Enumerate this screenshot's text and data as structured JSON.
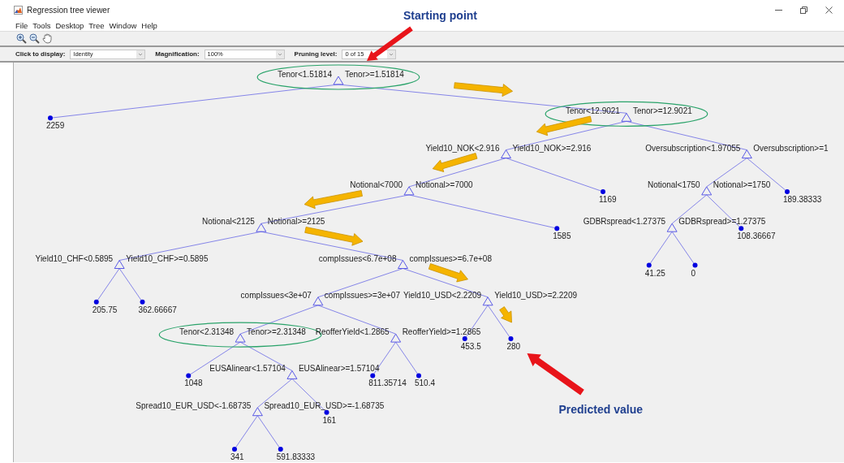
{
  "window": {
    "title": "Regression tree viewer"
  },
  "menu": [
    "File",
    "Tools",
    "Desktop",
    "Tree",
    "Window",
    "Help"
  ],
  "options": [
    {
      "label": "Click to display:",
      "value": "Identity"
    },
    {
      "label": "Magnification:",
      "value": "100%"
    },
    {
      "label": "Pruning level:",
      "value": "0 of 15"
    }
  ],
  "tree": {
    "kind": "split",
    "left_label": "Tenor<1.51814",
    "right_label": "Tenor>=1.51814",
    "highlighted": true,
    "children": [
      {
        "kind": "leaf",
        "value": "2259",
        "on_path": false
      },
      {
        "kind": "split",
        "left_label": "Tenor<12.9021",
        "right_label": "Tenor>=12.9021",
        "highlighted": true,
        "on_path": true,
        "children": [
          {
            "kind": "split",
            "left_label": "Yield10_NOK<2.916",
            "right_label": "Yield10_NOK>=2.916",
            "highlighted": false,
            "on_path": true,
            "children": [
              {
                "kind": "split",
                "left_label": "Notional<7000",
                "right_label": "Notional>=7000",
                "highlighted": false,
                "on_path": true,
                "children": [
                  {
                    "kind": "split",
                    "left_label": "Notional<2125",
                    "right_label": "Notional>=2125",
                    "highlighted": false,
                    "on_path": true,
                    "children": [
                      {
                        "kind": "split",
                        "left_label": "Yield10_CHF<0.5895",
                        "right_label": "Yield10_CHF>=0.5895",
                        "highlighted": false,
                        "on_path": false,
                        "children": [
                          {
                            "kind": "leaf",
                            "value": "205.75",
                            "on_path": false
                          },
                          {
                            "kind": "leaf",
                            "value": "362.66667",
                            "on_path": false
                          }
                        ]
                      },
                      {
                        "kind": "split",
                        "left_label": "compIssues<6.7e+08",
                        "right_label": "compIssues>=6.7e+08",
                        "highlighted": false,
                        "on_path": true,
                        "children": [
                          {
                            "kind": "split",
                            "left_label": "compIssues<3e+07",
                            "right_label": "compIssues>=3e+07",
                            "highlighted": false,
                            "on_path": false,
                            "children": [
                              {
                                "kind": "split",
                                "left_label": "Tenor<2.31348",
                                "right_label": "Tenor>=2.31348",
                                "highlighted": true,
                                "on_path": false,
                                "children": [
                                  {
                                    "kind": "leaf",
                                    "value": "1048",
                                    "on_path": false
                                  },
                                  {
                                    "kind": "split",
                                    "left_label": "EUSAlinear<1.57104",
                                    "right_label": "EUSAlinear>=1.57104",
                                    "highlighted": false,
                                    "on_path": false,
                                    "children": [
                                      {
                                        "kind": "split",
                                        "left_label": "Spread10_EUR_USD<-1.68735",
                                        "right_label": "Spread10_EUR_USD>=-1.68735",
                                        "highlighted": false,
                                        "on_path": false,
                                        "children": [
                                          {
                                            "kind": "leaf",
                                            "value": "341",
                                            "on_path": false
                                          },
                                          {
                                            "kind": "leaf",
                                            "value": "591.83333",
                                            "on_path": false
                                          }
                                        ]
                                      },
                                      {
                                        "kind": "leaf",
                                        "value": "161",
                                        "on_path": false
                                      }
                                    ]
                                  }
                                ]
                              },
                              {
                                "kind": "split",
                                "left_label": "ReofferYield<1.2865",
                                "right_label": "ReofferYield>=1.2865",
                                "highlighted": false,
                                "on_path": false,
                                "children": [
                                  {
                                    "kind": "leaf",
                                    "value": "811.35714",
                                    "on_path": false
                                  },
                                  {
                                    "kind": "leaf",
                                    "value": "510.4",
                                    "on_path": false
                                  }
                                ]
                              }
                            ]
                          },
                          {
                            "kind": "split",
                            "left_label": "Yield10_USD<2.2209",
                            "right_label": "Yield10_USD>=2.2209",
                            "highlighted": false,
                            "on_path": true,
                            "children": [
                              {
                                "kind": "leaf",
                                "value": "453.5",
                                "on_path": false
                              },
                              {
                                "kind": "leaf",
                                "value": "280",
                                "on_path": true
                              }
                            ]
                          }
                        ]
                      }
                    ]
                  },
                  {
                    "kind": "leaf",
                    "value": "1585",
                    "on_path": false
                  }
                ]
              },
              {
                "kind": "leaf",
                "value": "1169",
                "on_path": false
              }
            ]
          },
          {
            "kind": "split",
            "left_label": "Oversubscription<1.97055",
            "right_label": "Oversubscription>=1",
            "highlighted": false,
            "on_path": false,
            "children": [
              {
                "kind": "split",
                "left_label": "Notional<1750",
                "right_label": "Notional>=1750",
                "highlighted": false,
                "on_path": false,
                "children": [
                  {
                    "kind": "split",
                    "left_label": "GDBRspread<1.27375",
                    "right_label": "GDBRspread>=1.27375",
                    "highlighted": false,
                    "on_path": false,
                    "children": [
                      {
                        "kind": "leaf",
                        "value": "41.25",
                        "on_path": false
                      },
                      {
                        "kind": "leaf",
                        "value": "0",
                        "on_path": false
                      }
                    ]
                  },
                  {
                    "kind": "leaf",
                    "value": "108.36667",
                    "on_path": false
                  }
                ]
              },
              {
                "kind": "leaf",
                "value": "189.38333",
                "on_path": false
              }
            ]
          }
        ]
      }
    ]
  },
  "callouts": [
    {
      "text": "Starting point",
      "kind": "control"
    },
    {
      "text": "Predicted value",
      "kind": "leaf"
    }
  ]
}
